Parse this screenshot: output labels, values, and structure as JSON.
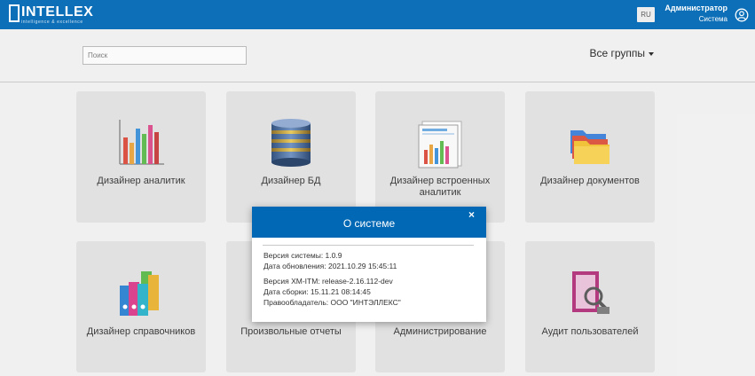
{
  "header": {
    "logo_text": "INTELLEX",
    "logo_tagline": "intelligence & excellence",
    "language": "RU",
    "user_name": "Администратор",
    "user_role": "Система",
    "brand_color": "#0068b4"
  },
  "toolbar": {
    "search_placeholder": "Поиск",
    "groups_label": "Все группы"
  },
  "tiles": [
    {
      "label": "Дизайнер аналитик",
      "icon": "bar-chart-icon"
    },
    {
      "label": "Дизайнер БД",
      "icon": "database-icon"
    },
    {
      "label": "Дизайнер встроенных аналитик",
      "icon": "embedded-chart-icon"
    },
    {
      "label": "Дизайнер документов",
      "icon": "folders-icon"
    },
    {
      "label": "Дизайнер справочников",
      "icon": "binders-icon"
    },
    {
      "label": "Произвольные отчеты",
      "icon": "report-icon"
    },
    {
      "label": "Администрирование",
      "icon": "admin-icon"
    },
    {
      "label": "Аудит пользователей",
      "icon": "audit-icon"
    }
  ],
  "modal": {
    "title": "О системе",
    "close": "×",
    "system_version": "Версия системы: 1.0.9",
    "update_date": "Дата обновления: 2021.10.29 15:45:11",
    "xm_version": "Версия XM-ITM: release-2.16.112-dev",
    "build_date": "Дата сборки: 15.11.21 08:14:45",
    "owner": "Правообладатель: ООО \"ИНТЭЛЛЕКС\""
  }
}
